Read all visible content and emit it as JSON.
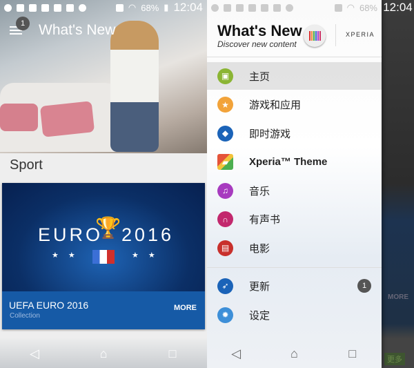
{
  "status_bar": {
    "battery": "68%",
    "time": "12:04"
  },
  "left": {
    "app_title": "What's New",
    "menu_badge": "1",
    "section_title": "Sport",
    "card": {
      "banner_left": "EURO",
      "banner_right": "2016",
      "title": "UEFA EURO 2016",
      "subtitle": "Collection",
      "more_label": "MORE"
    }
  },
  "drawer": {
    "title": "What's New",
    "subtitle": "Discover new content",
    "brand": "XPERIA",
    "items": [
      {
        "label": "主页",
        "icon": "home-icon",
        "color": "#8bb534"
      },
      {
        "label": "游戏和应用",
        "icon": "star-icon",
        "color": "#f2a33a"
      },
      {
        "label": "即时游戏",
        "icon": "gamepad-icon",
        "color": "#1b63b8"
      },
      {
        "label": "Xperia™ Theme",
        "icon": "theme-icon",
        "color": "#e5543a"
      },
      {
        "label": "音乐",
        "icon": "music-icon",
        "color": "#a73bbf"
      },
      {
        "label": "有声书",
        "icon": "headphones-icon",
        "color": "#c2286d"
      },
      {
        "label": "电影",
        "icon": "film-icon",
        "color": "#c8302c"
      }
    ],
    "bottom_items": [
      {
        "label": "更新",
        "icon": "update-icon",
        "color": "#1b63b8",
        "badge": "1"
      },
      {
        "label": "设定",
        "icon": "gear-icon",
        "color": "#3d8fd8"
      }
    ],
    "dimmed_more": "MORE",
    "dimmed_cn_more": "更多"
  },
  "nav": {
    "back": "◁",
    "home": "⌂",
    "recents": "□"
  }
}
